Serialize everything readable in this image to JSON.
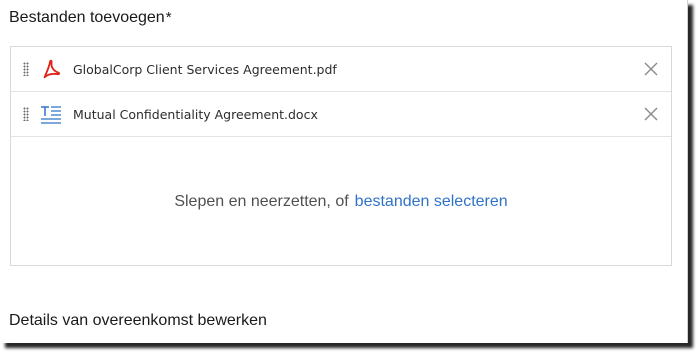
{
  "section": {
    "title": "Bestanden toevoegen",
    "required_mark": "*"
  },
  "files": [
    {
      "name": "GlobalCorp Client Services Agreement.pdf",
      "icon": "pdf-icon",
      "color": "#e0231b"
    },
    {
      "name": "Mutual Confidentiality Agreement.docx",
      "icon": "text-document-icon",
      "color": "#2f73c9"
    }
  ],
  "dropzone": {
    "text": "Slepen en neerzetten, of",
    "link": "bestanden selecteren"
  },
  "details": {
    "title": "Details van overeenkomst bewerken"
  },
  "colors": {
    "link": "#2f73c9",
    "pdf": "#e0231b"
  }
}
